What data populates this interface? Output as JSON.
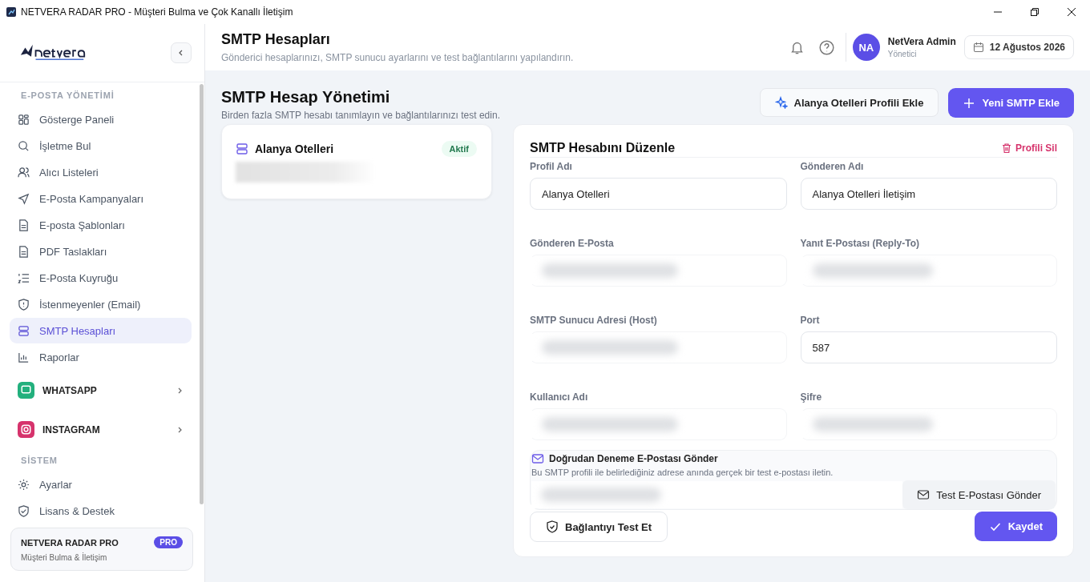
{
  "window": {
    "title": "NETVERA RADAR PRO - Müşteri Bulma ve Çok Kanallı İletişim"
  },
  "sidebar": {
    "sections": [
      {
        "title": "E-POSTA YÖNETİMİ",
        "items": [
          {
            "label": "Gösterge Paneli",
            "selected": false
          },
          {
            "label": "İşletme Bul",
            "selected": false
          },
          {
            "label": "Alıcı Listeleri",
            "selected": false
          },
          {
            "label": "E-Posta Kampanyaları",
            "selected": false
          },
          {
            "label": "E-posta Şablonları",
            "selected": false
          },
          {
            "label": "PDF Taslakları",
            "selected": false
          },
          {
            "label": "E-Posta Kuyruğu",
            "selected": false
          },
          {
            "label": "İstenmeyenler (Email)",
            "selected": false
          },
          {
            "label": "SMTP Hesapları",
            "selected": true
          },
          {
            "label": "Raporlar",
            "selected": false
          }
        ]
      },
      {
        "groups": [
          {
            "label": "WHATSAPP",
            "color": "#22b07d",
            "expanded": false
          },
          {
            "label": "INSTAGRAM",
            "color": "#d6336c",
            "expanded": false
          }
        ]
      },
      {
        "title": "SİSTEM",
        "items": [
          {
            "label": "Ayarlar",
            "selected": false
          },
          {
            "label": "Lisans & Destek",
            "selected": false
          }
        ]
      }
    ],
    "footer": {
      "title": "NETVERA RADAR PRO",
      "badge": "PRO",
      "subtitle": "Müşteri Bulma & İletişim"
    }
  },
  "header": {
    "title": "SMTP Hesapları",
    "subtitle": "Gönderici hesaplarınızı, SMTP sunucu ayarlarını ve test bağlantılarını yapılandırın.",
    "user": {
      "initials": "NA",
      "name": "NetVera Admin",
      "role": "Yönetici"
    },
    "date": "12 Ağustos 2026"
  },
  "page": {
    "title": "SMTP Hesap Yönetimi",
    "subtitle": "Birden fazla SMTP hesabı tanımlayın ve bağlantılarınızı test edin.",
    "actions": [
      "Alanya Otelleri Profili Ekle",
      "Yeni SMTP Ekle"
    ]
  },
  "profiles": [
    {
      "name": "Alanya Otelleri",
      "status": "Aktif"
    }
  ],
  "editor": {
    "title": "SMTP Hesabını Düzenle",
    "delete": "Profili Sil",
    "fields": [
      {
        "label": "Profil Adı",
        "value": "Alanya Otelleri",
        "redacted": false
      },
      {
        "label": "Gönderen Adı",
        "value": "Alanya Otelleri İletişim",
        "redacted": false
      },
      {
        "label": "Gönderen E-Posta",
        "redacted": true
      },
      {
        "label": "Yanıt E-Postası (Reply-To)",
        "redacted": true
      },
      {
        "label": "SMTP Sunucu Adresi (Host)",
        "redacted": true
      },
      {
        "label": "Port",
        "value": "587",
        "redacted": false
      },
      {
        "label": "Kullanıcı Adı",
        "redacted": true
      },
      {
        "label": "Şifre",
        "redacted": true
      }
    ],
    "test_mail": {
      "title": "Doğrudan Deneme E-Postası Gönder",
      "description": "Bu SMTP profili ile belirlediğiniz adrese anında gerçek bir test e-postası iletin.",
      "redacted": true,
      "button": "Test E-Postası Gönder"
    },
    "test_button": "Bağlantıyı Test Et",
    "save_button": "Kaydet"
  }
}
